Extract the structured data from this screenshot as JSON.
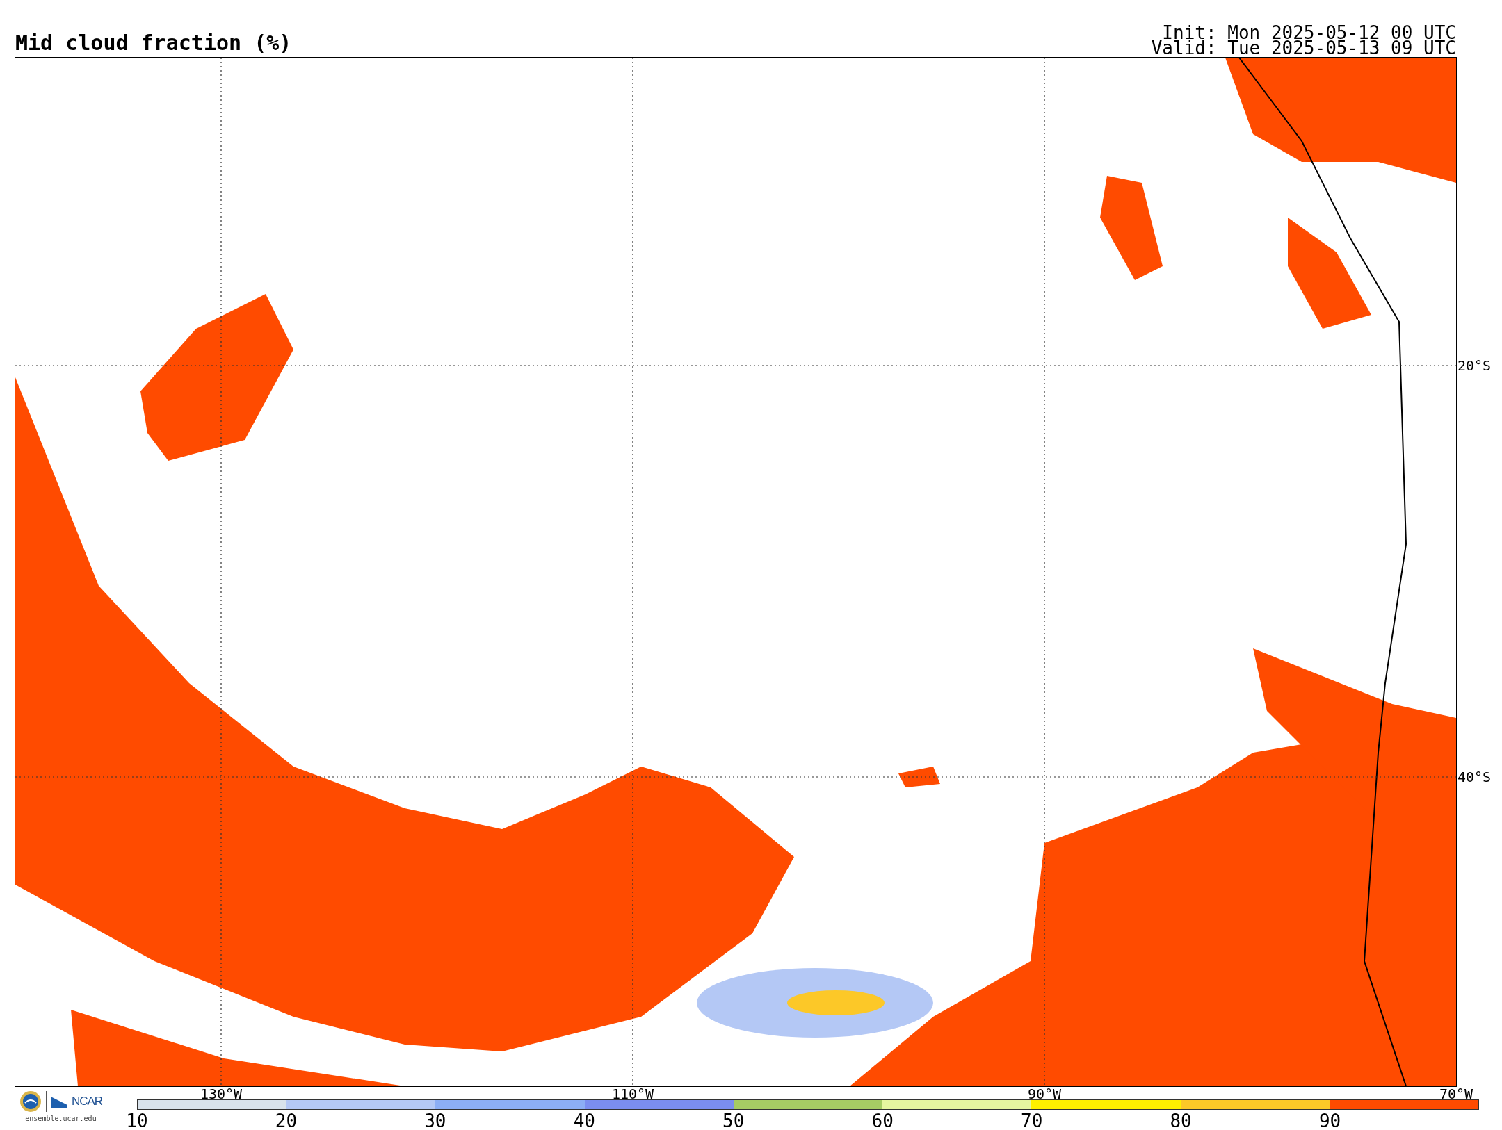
{
  "title": "Mid cloud fraction (%)",
  "init": "Init: Mon 2025-05-12 00 UTC",
  "valid": "Valid: Tue 2025-05-13 09 UTC",
  "map": {
    "lon_labels": [
      "130°W",
      "110°W",
      "90°W",
      "70°W"
    ],
    "lat_labels": [
      "20°S",
      "40°S"
    ]
  },
  "colorbar": {
    "bins": [
      {
        "label": "10",
        "color": "#d9e3ec"
      },
      {
        "label": "20",
        "color": "#b4c8f5"
      },
      {
        "label": "30",
        "color": "#8caef5"
      },
      {
        "label": "40",
        "color": "#7b8ef0"
      },
      {
        "label": "50",
        "color": "#a6cc64"
      },
      {
        "label": "60",
        "color": "#e6f5a0"
      },
      {
        "label": "70",
        "color": "#fff000"
      },
      {
        "label": "80",
        "color": "#fcc828"
      },
      {
        "label": "90",
        "color": "#ff4b00"
      }
    ]
  },
  "branding": {
    "logo_text": "NCAR",
    "url": "ensemble.ucar.edu"
  }
}
